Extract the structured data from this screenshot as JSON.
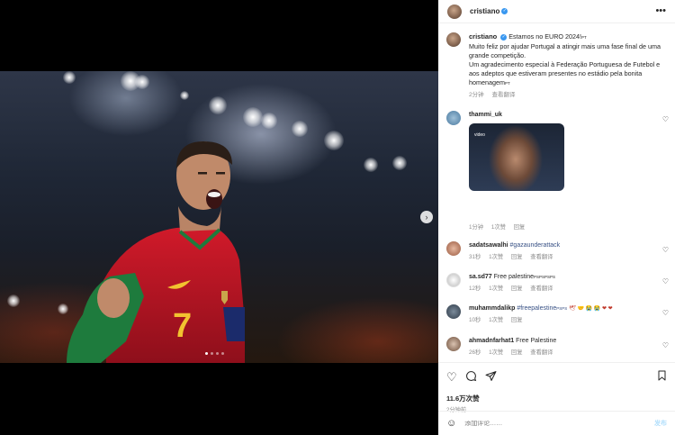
{
  "header": {
    "username": "cristiano",
    "more_icon": "more-horizontal-icon"
  },
  "caption": {
    "username": "cristiano",
    "line1": "Estamos no EURO 2024!",
    "line1_suffix": "PT",
    "line2": "Muito feliz por ajudar Portugal a atingir mais uma fase final de uma grande competição.",
    "line3": "Um agradecimento especial à Federação Portuguesa de Futebol e aos adeptos que estiveram presentes no estádio pela bonita homenagem",
    "line3_suffix": "PT",
    "time": "2分钟",
    "translate": "查看翻译"
  },
  "comments": [
    {
      "username": "thammi_uk",
      "text": "",
      "gif_label": "video",
      "time": "1分钟",
      "likes": "1次赞",
      "reply": "回复"
    },
    {
      "username": "sadatsawalhi",
      "text": "#gazaunderattack",
      "time": "31秒",
      "likes": "1次赞",
      "reply": "回复",
      "translate": "查看翻译"
    },
    {
      "username": "sa.sd77",
      "text": "Free palestine",
      "text_suffix": "PSPSPSPS",
      "time": "12秒",
      "likes": "1次赞",
      "reply": "回复",
      "translate": "查看翻译"
    },
    {
      "username": "muhammdalikp",
      "text": "#freepalestine",
      "text_suffix": "PSPS",
      "emoji": "🕊 🤝 😭 😭 ❤ ❤",
      "time": "10秒",
      "likes": "1次赞",
      "reply": "回复"
    },
    {
      "username": "ahmadnfarhat1",
      "text": "Free Palestine",
      "time": "26秒",
      "likes": "1次赞",
      "reply": "回复",
      "translate": "查看翻译"
    }
  ],
  "actions": {
    "likes": "11.6万次赞",
    "time": "2分钟前"
  },
  "add_comment": {
    "placeholder": "添加评论……",
    "post_label": "发布"
  },
  "carousel": {
    "slide_count": 4,
    "active_slide": 1
  },
  "colors": {
    "verified": "#3897f0",
    "link": "#385185",
    "muted": "#8e8e8e",
    "post_disabled": "#b2dffc"
  }
}
